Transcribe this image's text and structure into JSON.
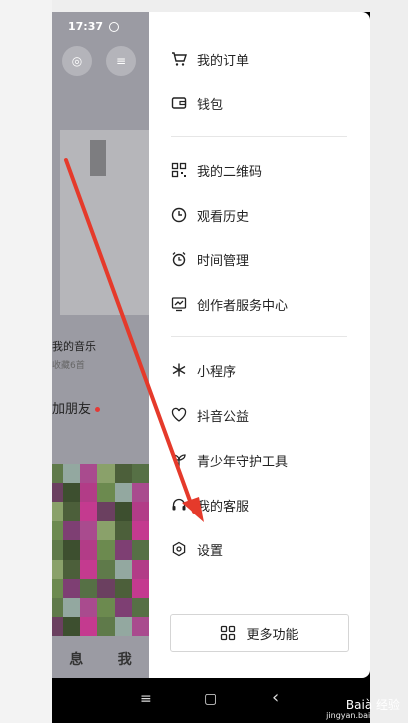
{
  "status_bar": {
    "time": "17:37",
    "alarm_icon": "alarm-clock-icon"
  },
  "background_app": {
    "top_buttons": [
      {
        "icon": "friends-icon",
        "glyph": "◎"
      },
      {
        "icon": "menu-icon",
        "glyph": "≡"
      }
    ],
    "music_label": "我的音乐",
    "music_sub": "收藏6首",
    "add_friend_label": "加朋友",
    "bottom_tabs": [
      "息",
      "我"
    ]
  },
  "drawer": {
    "items": [
      {
        "label": "我的订单",
        "icon": "cart-icon"
      },
      {
        "label": "钱包",
        "icon": "wallet-icon"
      },
      {
        "label": "我的二维码",
        "icon": "qrcode-icon"
      },
      {
        "label": "观看历史",
        "icon": "clock-icon"
      },
      {
        "label": "时间管理",
        "icon": "alarm-icon"
      },
      {
        "label": "创作者服务中心",
        "icon": "chart-icon"
      },
      {
        "label": "小程序",
        "icon": "mini-program-icon"
      },
      {
        "label": "抖音公益",
        "icon": "heart-icon"
      },
      {
        "label": "青少年守护工具",
        "icon": "sprout-icon"
      },
      {
        "label": "我的客服",
        "icon": "headset-icon"
      },
      {
        "label": "设置",
        "icon": "settings-icon"
      }
    ],
    "more_button": {
      "label": "更多功能",
      "icon": "grid-icon"
    }
  },
  "nav_bar": {
    "buttons": [
      {
        "name": "recent-apps-button",
        "glyph": "≡"
      },
      {
        "name": "home-button",
        "glyph": "▢"
      },
      {
        "name": "back-button",
        "glyph": "‹"
      }
    ]
  },
  "watermark": {
    "text": "Baià 经验",
    "sub": "jingyan.baidu.com"
  },
  "colors": {
    "arrow": "#e53a2b",
    "drawer_bg": "#ffffff",
    "dim_overlay": "#9b9ba3"
  }
}
